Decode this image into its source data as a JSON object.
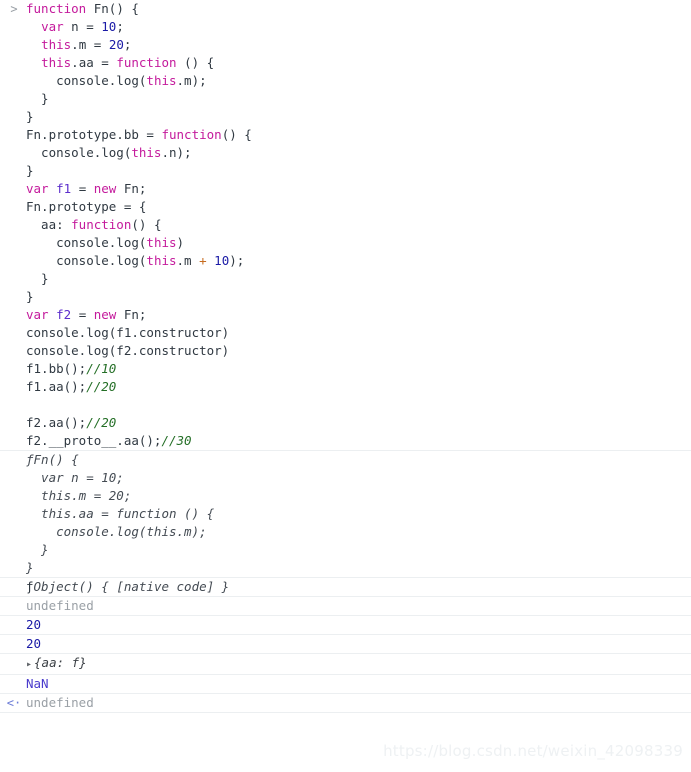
{
  "console": {
    "prompt_marker": ">",
    "result_marker": "<·",
    "expand_triangle": "▸",
    "function_glyph": "ƒ",
    "colors": {
      "keyword": "#c41a9c",
      "number": "#1a1aa6",
      "variable": "#5c2ecc",
      "operator": "#c66b1e",
      "comment": "#236e25",
      "plain_text": "#303942",
      "undefined_gray": "#9aa0a6",
      "nan_violet": "#4a3ccc",
      "function_glyph_blue": "#3344cc",
      "row_divider": "#eceff1",
      "background": "#ffffff"
    },
    "input_lines": [
      [
        {
          "t": "function",
          "c": "kw"
        },
        {
          "t": " ",
          "c": "plain"
        },
        {
          "t": "Fn() {",
          "c": "plain"
        }
      ],
      [
        {
          "t": "  ",
          "c": "plain"
        },
        {
          "t": "var",
          "c": "kw"
        },
        {
          "t": " n = ",
          "c": "plain"
        },
        {
          "t": "10",
          "c": "num"
        },
        {
          "t": ";",
          "c": "plain"
        }
      ],
      [
        {
          "t": "  ",
          "c": "plain"
        },
        {
          "t": "this",
          "c": "kw"
        },
        {
          "t": ".m = ",
          "c": "plain"
        },
        {
          "t": "20",
          "c": "num"
        },
        {
          "t": ";",
          "c": "plain"
        }
      ],
      [
        {
          "t": "  ",
          "c": "plain"
        },
        {
          "t": "this",
          "c": "kw"
        },
        {
          "t": ".aa = ",
          "c": "plain"
        },
        {
          "t": "function",
          "c": "kw"
        },
        {
          "t": " () {",
          "c": "plain"
        }
      ],
      [
        {
          "t": "    console.log(",
          "c": "plain"
        },
        {
          "t": "this",
          "c": "kw"
        },
        {
          "t": ".m);",
          "c": "plain"
        }
      ],
      [
        {
          "t": "  }",
          "c": "plain"
        }
      ],
      [
        {
          "t": "}",
          "c": "plain"
        }
      ],
      [
        {
          "t": "Fn.prototype.bb = ",
          "c": "plain"
        },
        {
          "t": "function",
          "c": "kw"
        },
        {
          "t": "() {",
          "c": "plain"
        }
      ],
      [
        {
          "t": "  console.log(",
          "c": "plain"
        },
        {
          "t": "this",
          "c": "kw"
        },
        {
          "t": ".n);",
          "c": "plain"
        }
      ],
      [
        {
          "t": "}",
          "c": "plain"
        }
      ],
      [
        {
          "t": "var",
          "c": "kw"
        },
        {
          "t": " ",
          "c": "plain"
        },
        {
          "t": "f1",
          "c": "var"
        },
        {
          "t": " = ",
          "c": "plain"
        },
        {
          "t": "new",
          "c": "kw"
        },
        {
          "t": " Fn;",
          "c": "plain"
        }
      ],
      [
        {
          "t": "Fn.prototype = {",
          "c": "plain"
        }
      ],
      [
        {
          "t": "  aa: ",
          "c": "plain"
        },
        {
          "t": "function",
          "c": "kw"
        },
        {
          "t": "() {",
          "c": "plain"
        }
      ],
      [
        {
          "t": "    console.log(",
          "c": "plain"
        },
        {
          "t": "this",
          "c": "kw"
        },
        {
          "t": ")",
          "c": "plain"
        }
      ],
      [
        {
          "t": "    console.log(",
          "c": "plain"
        },
        {
          "t": "this",
          "c": "kw"
        },
        {
          "t": ".m ",
          "c": "plain"
        },
        {
          "t": "+",
          "c": "op"
        },
        {
          "t": " ",
          "c": "plain"
        },
        {
          "t": "10",
          "c": "num"
        },
        {
          "t": ");",
          "c": "plain"
        }
      ],
      [
        {
          "t": "  }",
          "c": "plain"
        }
      ],
      [
        {
          "t": "}",
          "c": "plain"
        }
      ],
      [
        {
          "t": "var",
          "c": "kw"
        },
        {
          "t": " ",
          "c": "plain"
        },
        {
          "t": "f2",
          "c": "var"
        },
        {
          "t": " = ",
          "c": "plain"
        },
        {
          "t": "new",
          "c": "kw"
        },
        {
          "t": " Fn;",
          "c": "plain"
        }
      ],
      [
        {
          "t": "console.log(f1.constructor)",
          "c": "plain"
        }
      ],
      [
        {
          "t": "console.log(f2.constructor)",
          "c": "plain"
        }
      ],
      [
        {
          "t": "f1.bb();",
          "c": "plain"
        },
        {
          "t": "//10",
          "c": "comment"
        }
      ],
      [
        {
          "t": "f1.aa();",
          "c": "plain"
        },
        {
          "t": "//20",
          "c": "comment"
        }
      ],
      [
        {
          "t": "",
          "c": "plain"
        }
      ],
      [
        {
          "t": "f2.aa();",
          "c": "plain"
        },
        {
          "t": "//20",
          "c": "comment"
        }
      ],
      [
        {
          "t": "f2.__proto__.aa();",
          "c": "plain"
        },
        {
          "t": "//30",
          "c": "comment"
        }
      ]
    ],
    "output_function_block": {
      "glyph": "ƒ",
      "lines": [
        "Fn() {",
        "  var n = 10;",
        "  this.m = 20;",
        "  this.aa = function () {",
        "    console.log(this.m);",
        "  }",
        "}"
      ]
    },
    "output_rows": [
      {
        "kind": "function",
        "glyph": "ƒ",
        "text": "Object() { [native code] }",
        "marker": ""
      },
      {
        "kind": "undefined",
        "text": "undefined",
        "marker": ""
      },
      {
        "kind": "number",
        "text": "20",
        "marker": ""
      },
      {
        "kind": "number",
        "text": "20",
        "marker": ""
      },
      {
        "kind": "object",
        "triangle": "▸",
        "text": "{aa: f}",
        "marker": ""
      },
      {
        "kind": "nan",
        "text": "NaN",
        "marker": ""
      },
      {
        "kind": "result-undefined",
        "text": "undefined",
        "marker": "<·"
      }
    ]
  },
  "watermark": {
    "text": "https://blog.csdn.net/weixin_42098339"
  }
}
